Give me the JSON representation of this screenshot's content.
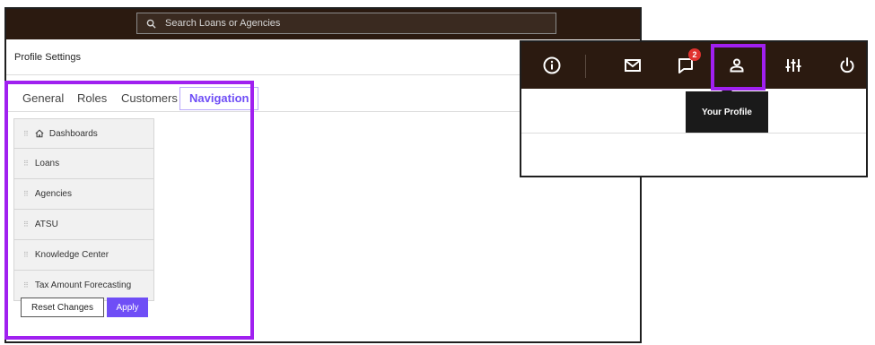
{
  "search": {
    "placeholder": "Search Loans or Agencies"
  },
  "header": {
    "title": "Profile Settings"
  },
  "tabs": [
    {
      "label": "General"
    },
    {
      "label": "Roles"
    },
    {
      "label": "Customers"
    },
    {
      "label": "Navigation",
      "active": true
    }
  ],
  "nav_items": [
    {
      "label": "Dashboards",
      "icon": "home-icon"
    },
    {
      "label": "Loans"
    },
    {
      "label": "Agencies"
    },
    {
      "label": "ATSU"
    },
    {
      "label": "Knowledge Center"
    },
    {
      "label": "Tax Amount Forecasting"
    }
  ],
  "buttons": {
    "reset_label": "Reset Changes",
    "apply_label": "Apply"
  },
  "toolbar": {
    "icons": [
      "info-icon",
      "mail-icon",
      "chat-icon",
      "profile-icon",
      "sliders-icon",
      "power-icon"
    ],
    "chat_badge": "2",
    "tooltip": "Your Profile"
  },
  "colors": {
    "topbar": "#2b1a10",
    "accent": "#6f4ef6",
    "highlight": "#a020f0",
    "badge": "#e0322f"
  }
}
